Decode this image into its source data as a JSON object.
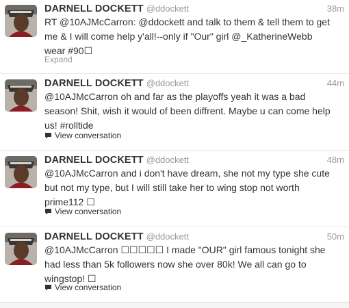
{
  "tweets": [
    {
      "fullname": "DARNELL DOCKETT",
      "username": "@ddockett",
      "time": "38m",
      "text": "RT @10AJMcCarron: @ddockett and talk to them & tell them to get me & I will come help y'all!--only if \"Our\" girl @_KatherineWebb wear #90☐",
      "footer": "Expand"
    },
    {
      "fullname": "DARNELL DOCKETT",
      "username": "@ddockett",
      "time": "44m",
      "text": "@10AJMcCarron oh and far as the playoffs yeah it was a bad season! Shit, wish it would of been diffrent. Maybe u can come help us! #rolltide",
      "footer": "View conversation"
    },
    {
      "fullname": "DARNELL DOCKETT",
      "username": "@ddockett",
      "time": "48m",
      "text": "@10AJMcCarron and i don't have dream, she not my type she cute but not my type, but I will still take her to wing stop not worth prime112 ☐",
      "footer": "View conversation"
    },
    {
      "fullname": "DARNELL DOCKETT",
      "username": "@ddockett",
      "time": "50m",
      "text": "@10AJMcCarron ☐☐☐☐☐ I made \"OUR\" girl famous tonight she had less than 5k followers now she over 80k! We all can go to wingstop! ☐",
      "footer": "View conversation"
    }
  ]
}
